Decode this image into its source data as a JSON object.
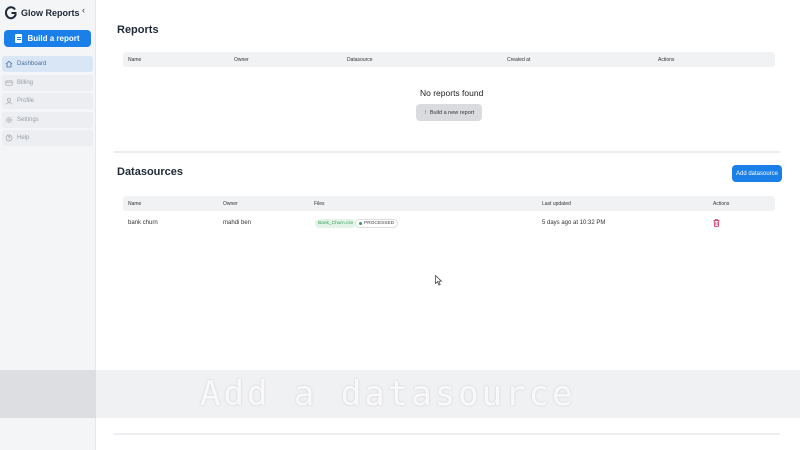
{
  "app": {
    "name": "Glow Reports",
    "collapse_glyph": "‹"
  },
  "sidebar": {
    "build_button": "Build a report",
    "items": [
      {
        "label": "Dashboard",
        "icon": "home-icon",
        "active": true
      },
      {
        "label": "Billing",
        "icon": "card-icon",
        "active": false
      },
      {
        "label": "Profile",
        "icon": "user-icon",
        "active": false
      },
      {
        "label": "Settings",
        "icon": "gear-icon",
        "active": false
      },
      {
        "label": "Help",
        "icon": "help-icon",
        "active": false
      }
    ]
  },
  "reports": {
    "title": "Reports",
    "columns": [
      "Name",
      "Owner",
      "Datasource",
      "Created at",
      "Actions"
    ],
    "empty_text": "No reports found",
    "new_button": "Build a new report",
    "new_button_icon": "↑"
  },
  "datasources": {
    "title": "Datasources",
    "add_button": "Add datasource",
    "columns": [
      "Name",
      "Owner",
      "Files",
      "Last updated",
      "Actions"
    ],
    "rows": [
      {
        "name": "bank churn",
        "owner": "mahdi ben",
        "file": "Bank_Churn.csv",
        "status": "PROCESSED",
        "updated": "5 days ago at 10:32 PM"
      }
    ]
  },
  "overlay": {
    "caption": "Add a datasource"
  },
  "colors": {
    "accent": "#1a7fe8",
    "delete": "#d0245a",
    "processed": "#2e9e5b"
  }
}
